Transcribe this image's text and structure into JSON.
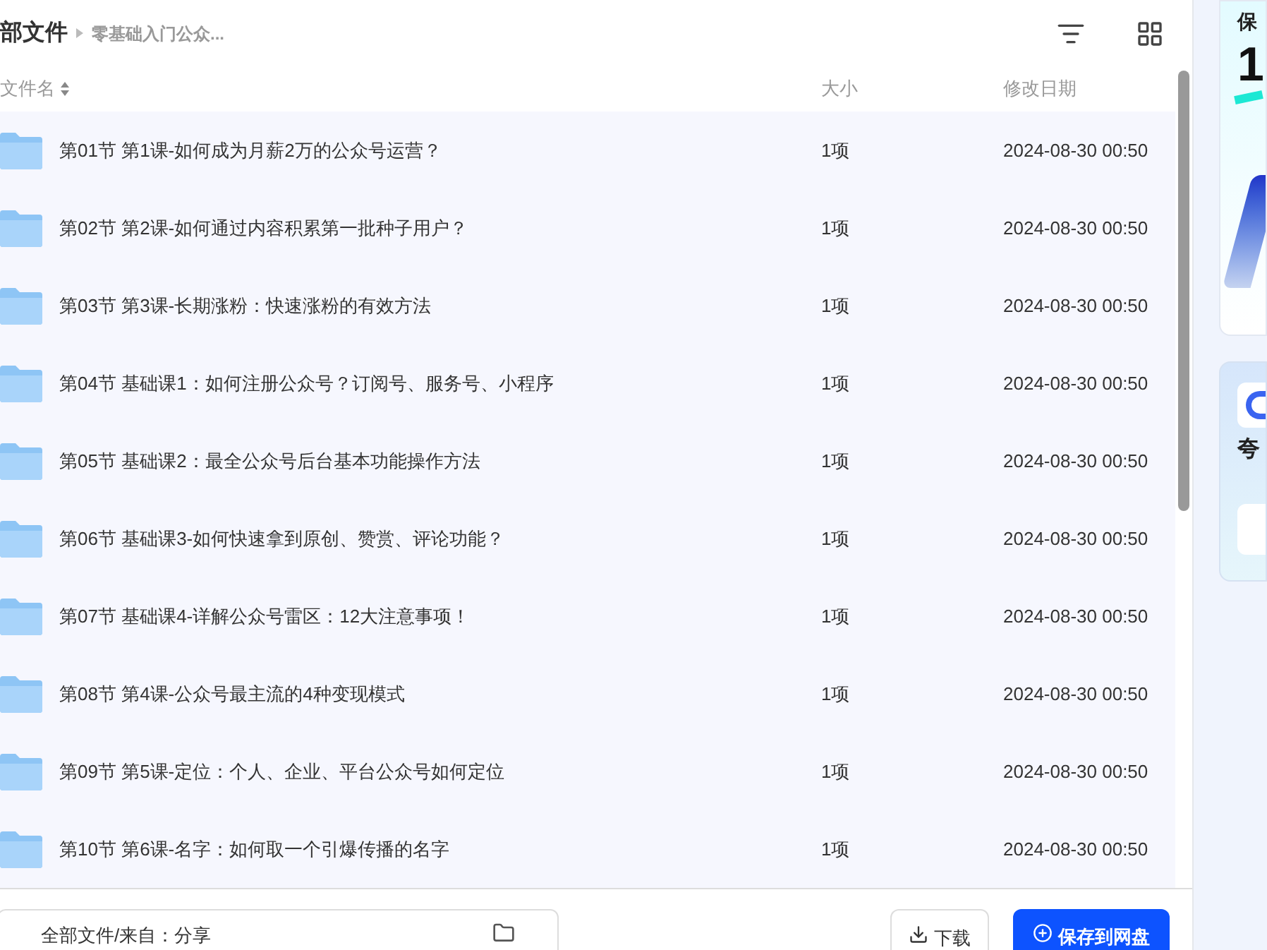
{
  "breadcrumb": {
    "current": "部文件",
    "sub": "零基础入门公众..."
  },
  "table": {
    "columns": [
      {
        "label": "文件名"
      },
      {
        "label": "大小"
      },
      {
        "label": "修改日期"
      }
    ],
    "rows": [
      {
        "name": "第01节 第1课-如何成为月薪2万的公众号运营？",
        "size": "1项",
        "date": "2024-08-30 00:50"
      },
      {
        "name": "第02节 第2课-如何通过内容积累第一批种子用户？",
        "size": "1项",
        "date": "2024-08-30 00:50"
      },
      {
        "name": "第03节 第3课-长期涨粉：快速涨粉的有效方法",
        "size": "1项",
        "date": "2024-08-30 00:50"
      },
      {
        "name": "第04节 基础课1：如何注册公众号？订阅号、服务号、小程序",
        "size": "1项",
        "date": "2024-08-30 00:50"
      },
      {
        "name": "第05节 基础课2：最全公众号后台基本功能操作方法",
        "size": "1项",
        "date": "2024-08-30 00:50"
      },
      {
        "name": "第06节 基础课3-如何快速拿到原创、赞赏、评论功能？",
        "size": "1项",
        "date": "2024-08-30 00:50"
      },
      {
        "name": "第07节 基础课4-详解公众号雷区：12大注意事项！",
        "size": "1项",
        "date": "2024-08-30 00:50"
      },
      {
        "name": "第08节 第4课-公众号最主流的4种变现模式",
        "size": "1项",
        "date": "2024-08-30 00:50"
      },
      {
        "name": "第09节 第5课-定位：个人、企业、平台公众号如何定位",
        "size": "1项",
        "date": "2024-08-30 00:50"
      },
      {
        "name": "第10节 第6课-名字：如何取一个引爆传播的名字",
        "size": "1项",
        "date": "2024-08-30 00:50"
      }
    ]
  },
  "footer": {
    "save_path": "全部文件/来自：分享",
    "buttons": [
      {
        "label": "下载",
        "kind": "secondary"
      },
      {
        "label": "保存到网盘",
        "kind": "primary"
      }
    ]
  },
  "side": {
    "card_title": "保",
    "card_number": "1",
    "app_title": "夸"
  }
}
